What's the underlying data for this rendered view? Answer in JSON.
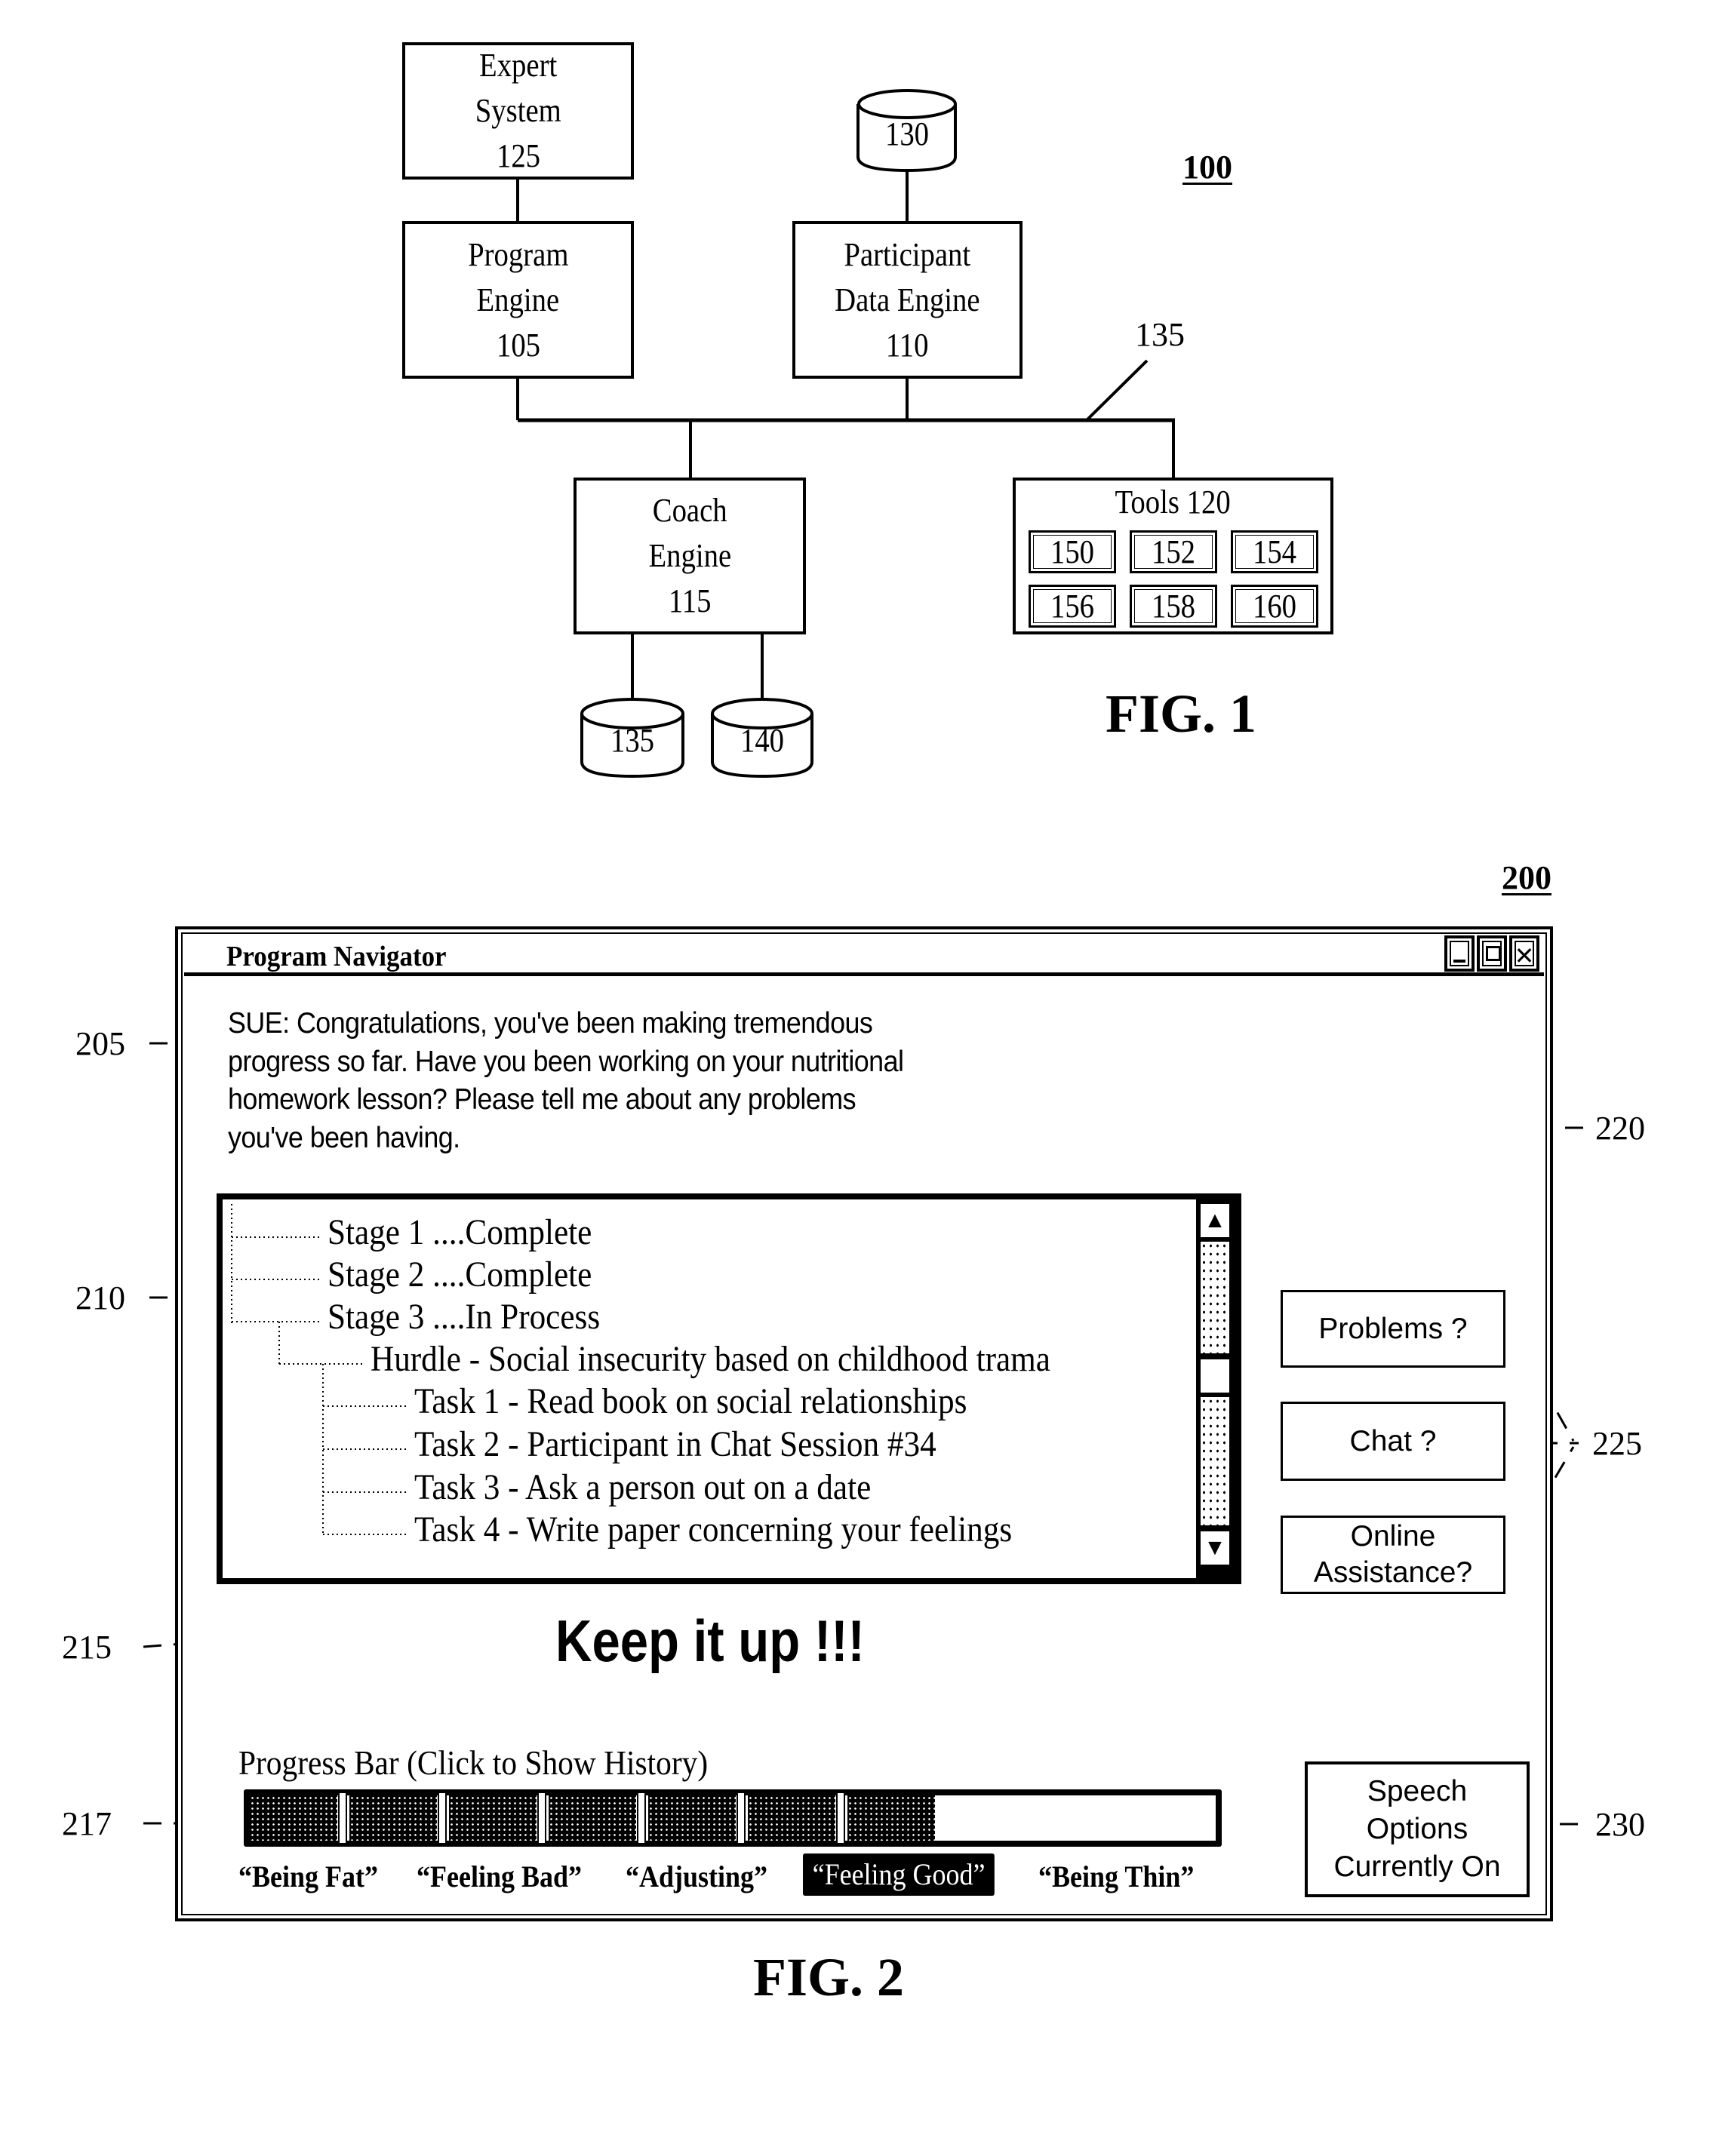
{
  "fig1": {
    "ref_label": "100",
    "caption": "FIG. 1",
    "expert_system": {
      "lines": [
        "Expert",
        "System",
        "125"
      ]
    },
    "program_engine": {
      "lines": [
        "Program",
        "Engine",
        "105"
      ]
    },
    "participant_data_engine": {
      "lines": [
        "Participant",
        "Data Engine",
        "110"
      ]
    },
    "coach_engine": {
      "lines": [
        "Coach",
        "Engine",
        "115"
      ]
    },
    "tools": {
      "title": "Tools 120",
      "items": [
        "150",
        "152",
        "154",
        "156",
        "158",
        "160"
      ]
    },
    "databases": {
      "participant_db": "130",
      "coach_db_1": "135",
      "coach_db_2": "140"
    },
    "network_label": "135"
  },
  "fig2": {
    "ref_label": "200",
    "caption": "FIG. 2",
    "callouts": {
      "bubble": "205",
      "tree": "210",
      "encouragement": "215",
      "progress": "217",
      "coach_avatar": "220",
      "help_buttons": "225",
      "speech_options": "230"
    },
    "window": {
      "title": "Program Navigator",
      "controls": {
        "minimize": "minimize-icon",
        "restore": "restore-icon",
        "close": "close-icon"
      }
    },
    "coach_message": {
      "lines": [
        "SUE: Congratulations, you've been making tremendous",
        "progress so far.  Have you been working on your nutritional",
        "homework lesson? Please tell me about any problems",
        "you've been having."
      ]
    },
    "program_tree": {
      "items": [
        {
          "level": 0,
          "text": "Stage 1 ....Complete"
        },
        {
          "level": 0,
          "text": "Stage 2 ....Complete"
        },
        {
          "level": 0,
          "text": "Stage 3 ....In Process"
        },
        {
          "level": 1,
          "text": "Hurdle - Social insecurity based on childhood trama"
        },
        {
          "level": 2,
          "text": "Task 1 - Read book on social relationships"
        },
        {
          "level": 2,
          "text": "Task 2 - Participant in Chat Session #34"
        },
        {
          "level": 2,
          "text": "Task 3 - Ask a person out on a date"
        },
        {
          "level": 2,
          "text": "Task 4 - Write paper concerning your feelings"
        }
      ],
      "scroll_up": "▲",
      "scroll_down": "▼"
    },
    "encouragement": "Keep it up !!!",
    "help_buttons": {
      "problems": [
        "Problems ?"
      ],
      "chat": [
        "Chat ?"
      ],
      "online": [
        "Online",
        "Assistance?"
      ]
    },
    "progress": {
      "label": "Progress Bar (Click to Show History)",
      "filled_segments": 7,
      "fraction": 0.71,
      "stages": [
        "“Being Fat”",
        "“Feeling Bad”",
        "“Adjusting”",
        "“Feeling Good”",
        "“Being Thin”"
      ],
      "current_stage_index": 3
    },
    "speech_options": [
      "Speech",
      "Options",
      "Currently On"
    ]
  }
}
